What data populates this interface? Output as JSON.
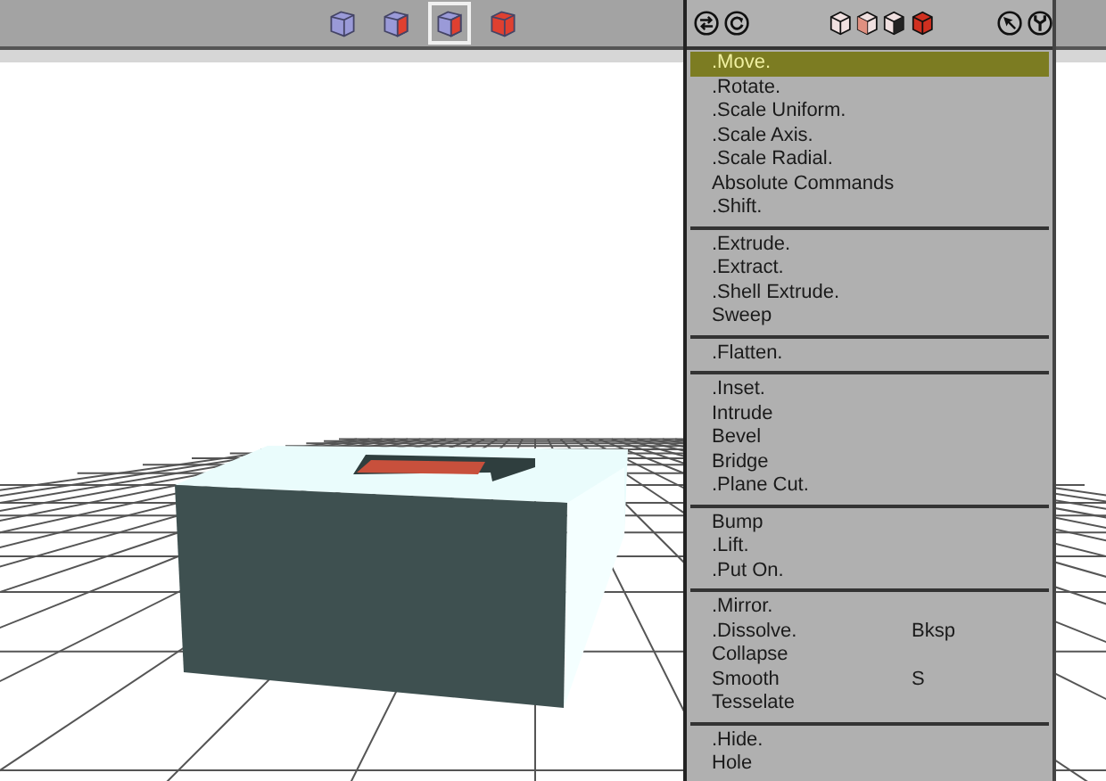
{
  "selection_modes": [
    {
      "selected": false
    },
    {
      "selected": false
    },
    {
      "selected": true
    },
    {
      "selected": false
    }
  ],
  "menu": {
    "groups": [
      {
        "items": [
          {
            "label": ".Move.",
            "selected": true
          },
          {
            "label": ".Rotate.",
            "selected": false
          },
          {
            "label": ".Scale Uniform.",
            "selected": false
          },
          {
            "label": ".Scale Axis.",
            "selected": false
          },
          {
            "label": ".Scale Radial.",
            "selected": false
          },
          {
            "label": "Absolute Commands",
            "selected": false
          },
          {
            "label": ".Shift.",
            "selected": false
          }
        ]
      },
      {
        "items": [
          {
            "label": ".Extrude.",
            "selected": false
          },
          {
            "label": ".Extract.",
            "selected": false
          },
          {
            "label": ".Shell Extrude.",
            "selected": false
          },
          {
            "label": "Sweep",
            "selected": false
          }
        ]
      },
      {
        "items": [
          {
            "label": ".Flatten.",
            "selected": false
          }
        ]
      },
      {
        "items": [
          {
            "label": ".Inset.",
            "selected": false
          },
          {
            "label": "Intrude",
            "selected": false
          },
          {
            "label": "Bevel",
            "selected": false
          },
          {
            "label": "Bridge",
            "selected": false
          },
          {
            "label": ".Plane Cut.",
            "selected": false
          }
        ]
      },
      {
        "items": [
          {
            "label": "Bump",
            "selected": false
          },
          {
            "label": ".Lift.",
            "selected": false
          },
          {
            "label": ".Put On.",
            "selected": false
          }
        ]
      },
      {
        "items": [
          {
            "label": ".Mirror.",
            "selected": false
          },
          {
            "label": ".Dissolve.",
            "shortcut": "Bksp",
            "selected": false
          },
          {
            "label": "Collapse",
            "selected": false
          },
          {
            "label": "Smooth",
            "shortcut": "S",
            "selected": false
          },
          {
            "label": "Tesselate",
            "selected": false
          }
        ]
      },
      {
        "items": [
          {
            "label": ".Hide.",
            "selected": false
          },
          {
            "label": "Hole",
            "selected": false
          }
        ]
      }
    ]
  }
}
